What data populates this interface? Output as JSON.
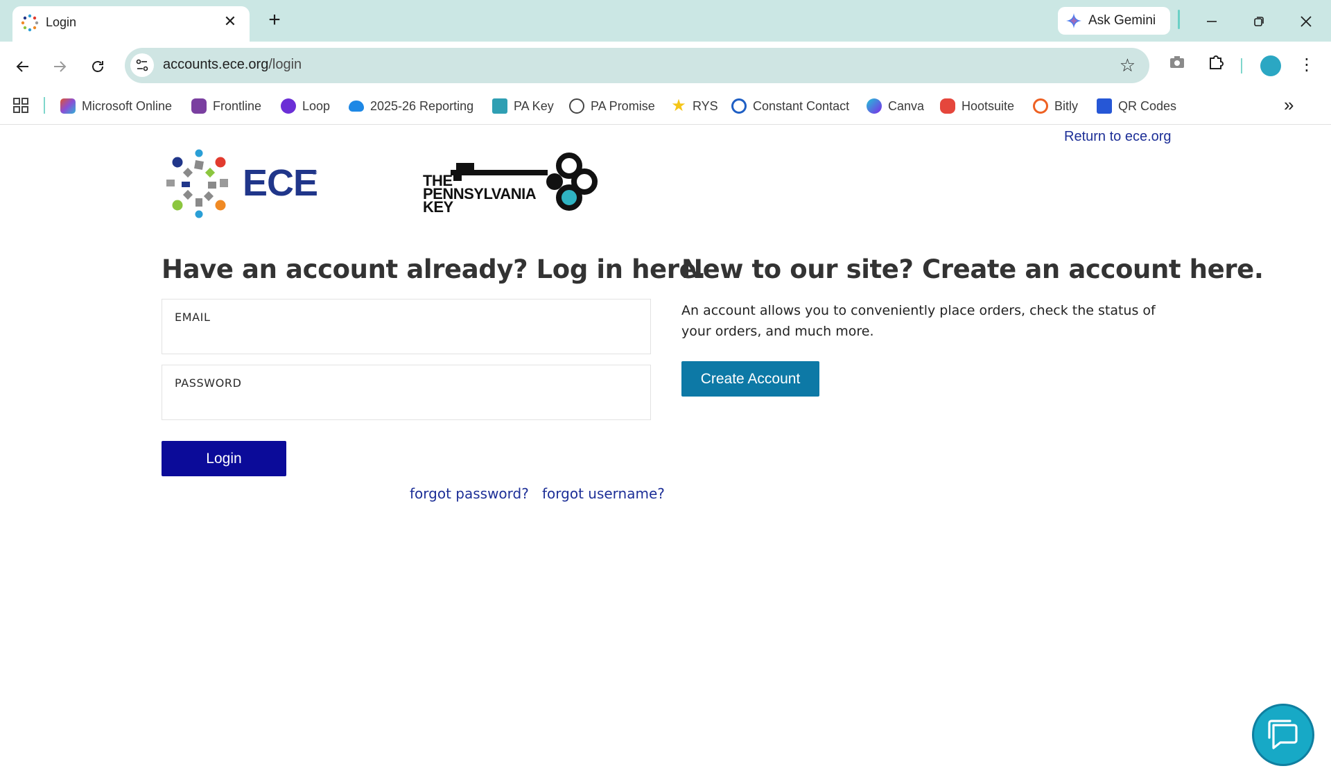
{
  "browser": {
    "tab_title": "Login",
    "tab_close": "✕",
    "new_tab": "+",
    "gemini_label": "Ask Gemini",
    "url_host": "accounts.ece.org",
    "url_path": "/login",
    "bookmarks": [
      {
        "label": "Microsoft Online",
        "color": "#e0552f"
      },
      {
        "label": "Frontline",
        "color": "#7a3fa0"
      },
      {
        "label": "Loop",
        "color": "#6b2fd6"
      },
      {
        "label": "2025-26 Reporting",
        "color": "#1e88e5"
      },
      {
        "label": "PA Key",
        "color": "#2f9fb3"
      },
      {
        "label": "PA Promise",
        "color": "#444444"
      },
      {
        "label": "RYS",
        "color": "#f5c518"
      },
      {
        "label": "Constant Contact",
        "color": "#1f5fc4"
      },
      {
        "label": "Canva",
        "color": "#7d2ae8"
      },
      {
        "label": "Hootsuite",
        "color": "#e5463c"
      },
      {
        "label": "Bitly",
        "color": "#ee6123"
      },
      {
        "label": "QR Codes",
        "color": "#2657d6"
      }
    ]
  },
  "page": {
    "return_link": "Return to ece.org",
    "ece_logo_text": "ECE",
    "pakey_logo_lines": [
      "THE",
      "PENNSYLVANIA",
      "KEY"
    ],
    "login": {
      "heading": "Have an account already? Log in here.",
      "email_label": "EMAIL",
      "password_label": "PASSWORD",
      "email_value": "",
      "password_value": "",
      "button": "Login",
      "forgot_password": "forgot password?",
      "forgot_username": "forgot username?"
    },
    "create": {
      "heading": "New to our site? Create an account here.",
      "description": "An account allows you to conveniently place orders, check the status of your orders, and much more.",
      "button": "Create Account"
    }
  },
  "colors": {
    "login_button": "#0b0b99",
    "create_button": "#0d79a6",
    "link": "#1d2f97",
    "chat_button": "#17a9c6"
  }
}
